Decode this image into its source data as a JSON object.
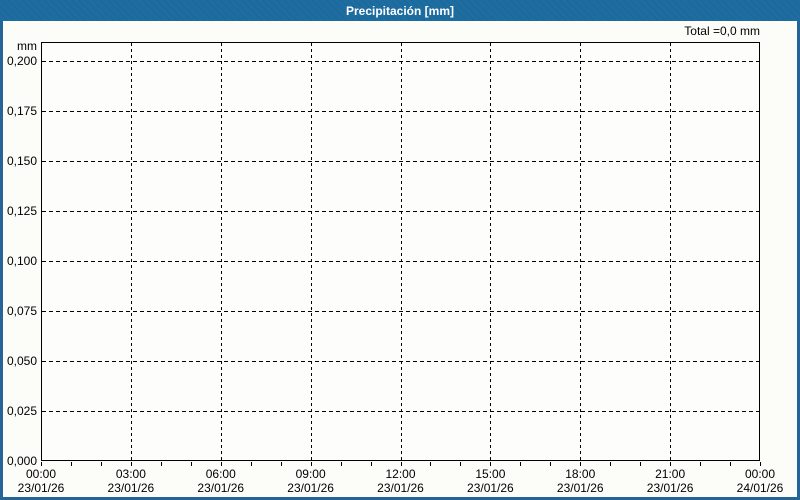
{
  "header": {
    "title": "Precipitación [mm]",
    "total_label": "Total =0,0 mm"
  },
  "colors": {
    "titlebar_blue": "#1d6da1",
    "window_border_blue": "#266497",
    "background": "#fcfdf8",
    "plot_background": "#fdfdfb",
    "grid_color": "#000000",
    "title_text": "#ffffff",
    "axis_text": "#000000"
  },
  "chart_data": {
    "type": "line",
    "title": "Precipitación [mm]",
    "ylabel": "mm",
    "total_annotation": "Total =0,0 mm",
    "grid": true,
    "ylim": [
      0,
      0.2095
    ],
    "y_ticks": [
      {
        "value": 0.2,
        "label": "0,200"
      },
      {
        "value": 0.175,
        "label": "0,175"
      },
      {
        "value": 0.15,
        "label": "0,150"
      },
      {
        "value": 0.125,
        "label": "0,125"
      },
      {
        "value": 0.1,
        "label": "0,100"
      },
      {
        "value": 0.075,
        "label": "0,075"
      },
      {
        "value": 0.05,
        "label": "0,050"
      },
      {
        "value": 0.025,
        "label": "0,025"
      },
      {
        "value": 0.0,
        "label": "0,000"
      }
    ],
    "x_span_hours": 24,
    "x_minor_tick_interval_hours": 1,
    "x_major_ticks": [
      {
        "hour": 0,
        "time": "00:00",
        "date": "23/01/26"
      },
      {
        "hour": 3,
        "time": "03:00",
        "date": "23/01/26"
      },
      {
        "hour": 6,
        "time": "06:00",
        "date": "23/01/26"
      },
      {
        "hour": 9,
        "time": "09:00",
        "date": "23/01/26"
      },
      {
        "hour": 12,
        "time": "12:00",
        "date": "23/01/26"
      },
      {
        "hour": 15,
        "time": "15:00",
        "date": "23/01/26"
      },
      {
        "hour": 18,
        "time": "18:00",
        "date": "23/01/26"
      },
      {
        "hour": 21,
        "time": "21:00",
        "date": "23/01/26"
      },
      {
        "hour": 24,
        "time": "00:00",
        "date": "24/01/26"
      }
    ],
    "series": [
      {
        "name": "Precipitación",
        "values": []
      }
    ],
    "total_mm": "0,0"
  }
}
